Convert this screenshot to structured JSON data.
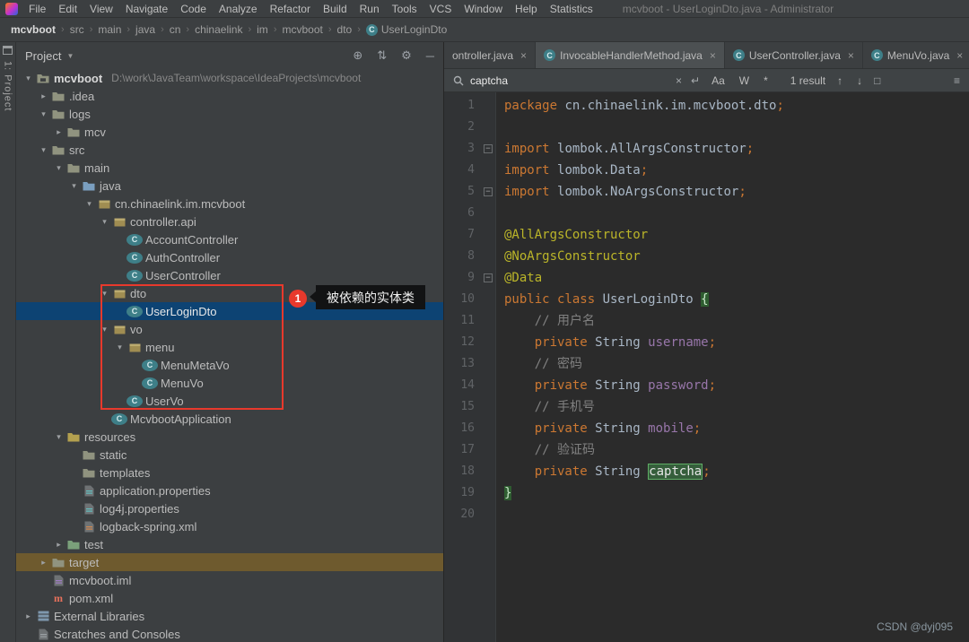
{
  "colors": {
    "selection_blue": "#0d4373",
    "target_row_highlight": "#6e5a2e",
    "annotation_red": "#e8392c",
    "keyword_orange": "#cc7832",
    "annotation_yellow": "#bbb529",
    "comment_gray": "#808080",
    "field_purple": "#9876aa",
    "editor_bg": "#2b2b2b",
    "panel_bg": "#3c3f41"
  },
  "title_bar": {
    "menus": [
      "File",
      "Edit",
      "View",
      "Navigate",
      "Code",
      "Analyze",
      "Refactor",
      "Build",
      "Run",
      "Tools",
      "VCS",
      "Window",
      "Help",
      "Statistics"
    ],
    "title": "mcvboot - UserLoginDto.java - Administrator"
  },
  "tool_strip": {
    "label": "1: Project"
  },
  "breadcrumb": {
    "items": [
      {
        "label": "mcvboot"
      },
      {
        "label": "src"
      },
      {
        "label": "main"
      },
      {
        "label": "java"
      },
      {
        "label": "cn"
      },
      {
        "label": "chinaelink"
      },
      {
        "label": "im"
      },
      {
        "label": "mcvboot"
      },
      {
        "label": "dto"
      },
      {
        "label": "UserLoginDto",
        "icon": "class"
      }
    ]
  },
  "project_panel": {
    "title": "Project",
    "tree": [
      {
        "label": "mcvboot",
        "extra": "D:\\work\\JavaTeam\\workspace\\IdeaProjects\\mcvboot",
        "indent": 0,
        "chevron": "down",
        "icon": "project",
        "bold": true
      },
      {
        "label": ".idea",
        "indent": 1,
        "chevron": "right",
        "icon": "folder"
      },
      {
        "label": "logs",
        "indent": 1,
        "chevron": "down",
        "icon": "folder"
      },
      {
        "label": "mcv",
        "indent": 2,
        "chevron": "right",
        "icon": "folder"
      },
      {
        "label": "src",
        "indent": 1,
        "chevron": "down",
        "icon": "folder"
      },
      {
        "label": "main",
        "indent": 2,
        "chevron": "down",
        "icon": "folder"
      },
      {
        "label": "java",
        "indent": 3,
        "chevron": "down",
        "icon": "folder-src"
      },
      {
        "label": "cn.chinaelink.im.mcvboot",
        "indent": 4,
        "chevron": "down",
        "icon": "package"
      },
      {
        "label": "controller.api",
        "indent": 5,
        "chevron": "down",
        "icon": "package"
      },
      {
        "label": "AccountController",
        "indent": 6,
        "icon": "class"
      },
      {
        "label": "AuthController",
        "indent": 6,
        "icon": "class"
      },
      {
        "label": "UserController",
        "indent": 6,
        "icon": "class"
      },
      {
        "label": "dto",
        "indent": 5,
        "chevron": "down",
        "icon": "package"
      },
      {
        "label": "UserLoginDto",
        "indent": 6,
        "icon": "class",
        "selected": true
      },
      {
        "label": "vo",
        "indent": 5,
        "chevron": "down",
        "icon": "package"
      },
      {
        "label": "menu",
        "indent": 6,
        "chevron": "down",
        "icon": "package"
      },
      {
        "label": "MenuMetaVo",
        "indent": 7,
        "icon": "class"
      },
      {
        "label": "MenuVo",
        "indent": 7,
        "icon": "class"
      },
      {
        "label": "UserVo",
        "indent": 6,
        "icon": "class"
      },
      {
        "label": "McvbootApplication",
        "indent": 5,
        "icon": "class-main"
      },
      {
        "label": "resources",
        "indent": 2,
        "chevron": "down",
        "icon": "folder-res"
      },
      {
        "label": "static",
        "indent": 3,
        "icon": "folder"
      },
      {
        "label": "templates",
        "indent": 3,
        "icon": "folder"
      },
      {
        "label": "application.properties",
        "indent": 3,
        "icon": "file-prop"
      },
      {
        "label": "log4j.properties",
        "indent": 3,
        "icon": "file-prop"
      },
      {
        "label": "logback-spring.xml",
        "indent": 3,
        "icon": "file-xml"
      },
      {
        "label": "test",
        "indent": 2,
        "chevron": "right",
        "icon": "folder-test"
      },
      {
        "label": "target",
        "indent": 1,
        "chevron": "right",
        "icon": "folder",
        "row_highlight": "target"
      },
      {
        "label": "mcvboot.iml",
        "indent": 1,
        "icon": "file-iml"
      },
      {
        "label": "pom.xml",
        "indent": 1,
        "icon": "file-maven"
      },
      {
        "label": "External Libraries",
        "indent": 0,
        "chevron": "right",
        "icon": "libraries"
      },
      {
        "label": "Scratches and Consoles",
        "indent": 0,
        "icon": "scratches"
      }
    ]
  },
  "annotation": {
    "badge": "1",
    "tooltip_text": "被依赖的实体类"
  },
  "editor": {
    "tabs": [
      {
        "label": "ontroller.java",
        "icon": "class",
        "clipped_left": true
      },
      {
        "label": "InvocableHandlerMethod.java",
        "icon": "class",
        "active": true
      },
      {
        "label": "UserController.java",
        "icon": "class"
      },
      {
        "label": "MenuVo.java",
        "icon": "class"
      }
    ],
    "search": {
      "query": "captcha",
      "toggles": [
        "Aa",
        "W",
        "*"
      ],
      "results_label": "1 result"
    },
    "code_lines": [
      {
        "n": 1,
        "tokens": [
          [
            "kw",
            "package "
          ],
          [
            "plain",
            "cn.chinaelink.im.mcvboot.dto"
          ],
          [
            "kw",
            ";"
          ]
        ]
      },
      {
        "n": 2,
        "tokens": []
      },
      {
        "n": 3,
        "fold": true,
        "tokens": [
          [
            "kw",
            "import "
          ],
          [
            "plain",
            "lombok.AllArgsConstructor"
          ],
          [
            "kw",
            ";"
          ]
        ]
      },
      {
        "n": 4,
        "tokens": [
          [
            "kw",
            "import "
          ],
          [
            "plain",
            "lombok.Data"
          ],
          [
            "kw",
            ";"
          ]
        ]
      },
      {
        "n": 5,
        "fold": true,
        "tokens": [
          [
            "kw",
            "import "
          ],
          [
            "plain",
            "lombok.NoArgsConstructor"
          ],
          [
            "kw",
            ";"
          ]
        ]
      },
      {
        "n": 6,
        "tokens": []
      },
      {
        "n": 7,
        "tokens": [
          [
            "ann",
            "@AllArgsConstructor"
          ]
        ]
      },
      {
        "n": 8,
        "tokens": [
          [
            "ann",
            "@NoArgsConstructor"
          ]
        ]
      },
      {
        "n": 9,
        "fold": true,
        "tokens": [
          [
            "ann",
            "@Data"
          ]
        ]
      },
      {
        "n": 10,
        "tokens": [
          [
            "kw",
            "public class "
          ],
          [
            "plain",
            "UserLoginDto "
          ],
          [
            "brace",
            "{"
          ]
        ]
      },
      {
        "n": 11,
        "tokens": [
          [
            "cm",
            "    // 用户名"
          ]
        ]
      },
      {
        "n": 12,
        "tokens": [
          [
            "plain",
            "    "
          ],
          [
            "kw",
            "private "
          ],
          [
            "plain",
            "String "
          ],
          [
            "field",
            "username"
          ],
          [
            "kw",
            ";"
          ]
        ]
      },
      {
        "n": 13,
        "tokens": [
          [
            "cm",
            "    // 密码"
          ]
        ]
      },
      {
        "n": 14,
        "tokens": [
          [
            "plain",
            "    "
          ],
          [
            "kw",
            "private "
          ],
          [
            "plain",
            "String "
          ],
          [
            "field",
            "password"
          ],
          [
            "kw",
            ";"
          ]
        ]
      },
      {
        "n": 15,
        "tokens": [
          [
            "cm",
            "    // 手机号"
          ]
        ]
      },
      {
        "n": 16,
        "tokens": [
          [
            "plain",
            "    "
          ],
          [
            "kw",
            "private "
          ],
          [
            "plain",
            "String "
          ],
          [
            "field",
            "mobile"
          ],
          [
            "kw",
            ";"
          ]
        ]
      },
      {
        "n": 17,
        "tokens": [
          [
            "cm",
            "    // 验证码"
          ]
        ]
      },
      {
        "n": 18,
        "tokens": [
          [
            "plain",
            "    "
          ],
          [
            "kw",
            "private "
          ],
          [
            "plain",
            "String "
          ],
          [
            "search",
            "captcha"
          ],
          [
            "kw",
            ";"
          ]
        ]
      },
      {
        "n": 19,
        "tokens": [
          [
            "brace",
            "}"
          ]
        ]
      },
      {
        "n": 20,
        "tokens": []
      }
    ]
  },
  "watermark": "CSDN @dyj095"
}
